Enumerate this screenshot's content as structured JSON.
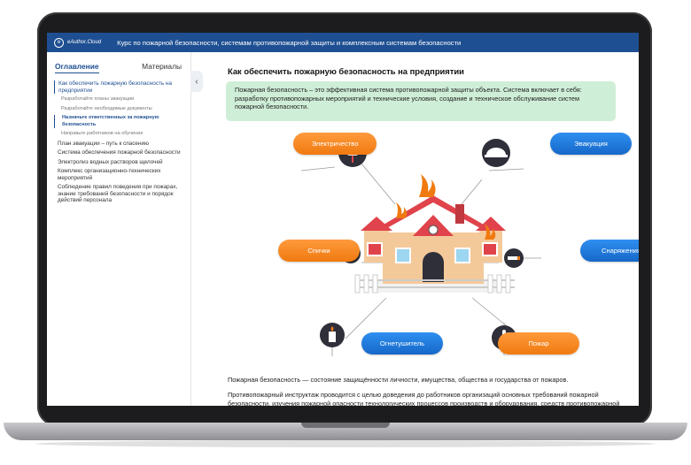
{
  "header": {
    "logo_text": "eAuthor.Cloud",
    "logo_glyph": "e",
    "course_title": "Курс по пожарной безопасности, системам противопожарной защиты и комплексным системам безопасности"
  },
  "sidebar": {
    "tabs": [
      {
        "label": "Оглавление",
        "active": true
      },
      {
        "label": "Материалы",
        "active": false
      }
    ],
    "toc": [
      {
        "label": "Как обеспечить пожарную безопасность на предприятии",
        "level": 1,
        "state": "current"
      },
      {
        "label": "Разработайте планы эвакуации",
        "level": 2,
        "state": ""
      },
      {
        "label": "Разработайте необходимые документы",
        "level": 2,
        "state": ""
      },
      {
        "label": "Назначьте ответственных за пожарную безопасность",
        "level": 2,
        "state": "current"
      },
      {
        "label": "Направьте работников на обучение",
        "level": 2,
        "state": ""
      },
      {
        "label": "План эвакуации – путь к спасению",
        "level": 1,
        "state": ""
      },
      {
        "label": "Система обеспечения пожарной безопасности",
        "level": 1,
        "state": ""
      },
      {
        "label": "Электролиз водных растворов щелочей",
        "level": 1,
        "state": ""
      },
      {
        "label": "Комплекс организационно-технических мероприятий",
        "level": 1,
        "state": ""
      },
      {
        "label": "Соблюдение правил поведения при пожарах, знание требований безопасности и порядок действий персонала",
        "level": 1,
        "state": ""
      }
    ],
    "collapse_icon": "chevron-left-icon"
  },
  "main": {
    "title": "Как обеспечить пожарную безопасность на предприятии",
    "infobox": "Пожарная безопасность – это эффективная система противопожарной защиты объекта. Система включает в себя: разработку противопожарных мероприятий и технические условия, создание и техническое обслуживание систем пожарной безопасности.",
    "diagram": {
      "labels": {
        "electricity": "Электричество",
        "evacuation": "Эвакуация",
        "matches": "Спички",
        "equipment": "Снаряжения",
        "extinguisher": "Огнетушитель",
        "fire": "Пожар"
      },
      "icons": [
        "plug-icon",
        "smoke-detector-icon",
        "match-icon",
        "cigarette-icon",
        "candle-icon",
        "thermometer-icon"
      ]
    },
    "paragraph1": "Пожарная безопасность — состояние защищённости личности, имущества, общества и государства от пожаров.",
    "paragraph2": "Противопожарный инструктаж проводится с целью доведения до работников организаций основных требований пожарной безопасности, изучения пожарной опасности технологических процессов производств и оборудования, средств противопожарной защиты, а также их действий в случае возникновения пожара."
  },
  "colors": {
    "header_blue": "#1e4f92",
    "info_green": "#cfeed7",
    "pill_orange": "#f58a23",
    "pill_blue": "#1f7fe0",
    "icon_circle": "#2f2f3a",
    "house_wall": "#f4c99a",
    "roof_red": "#e0434b"
  }
}
